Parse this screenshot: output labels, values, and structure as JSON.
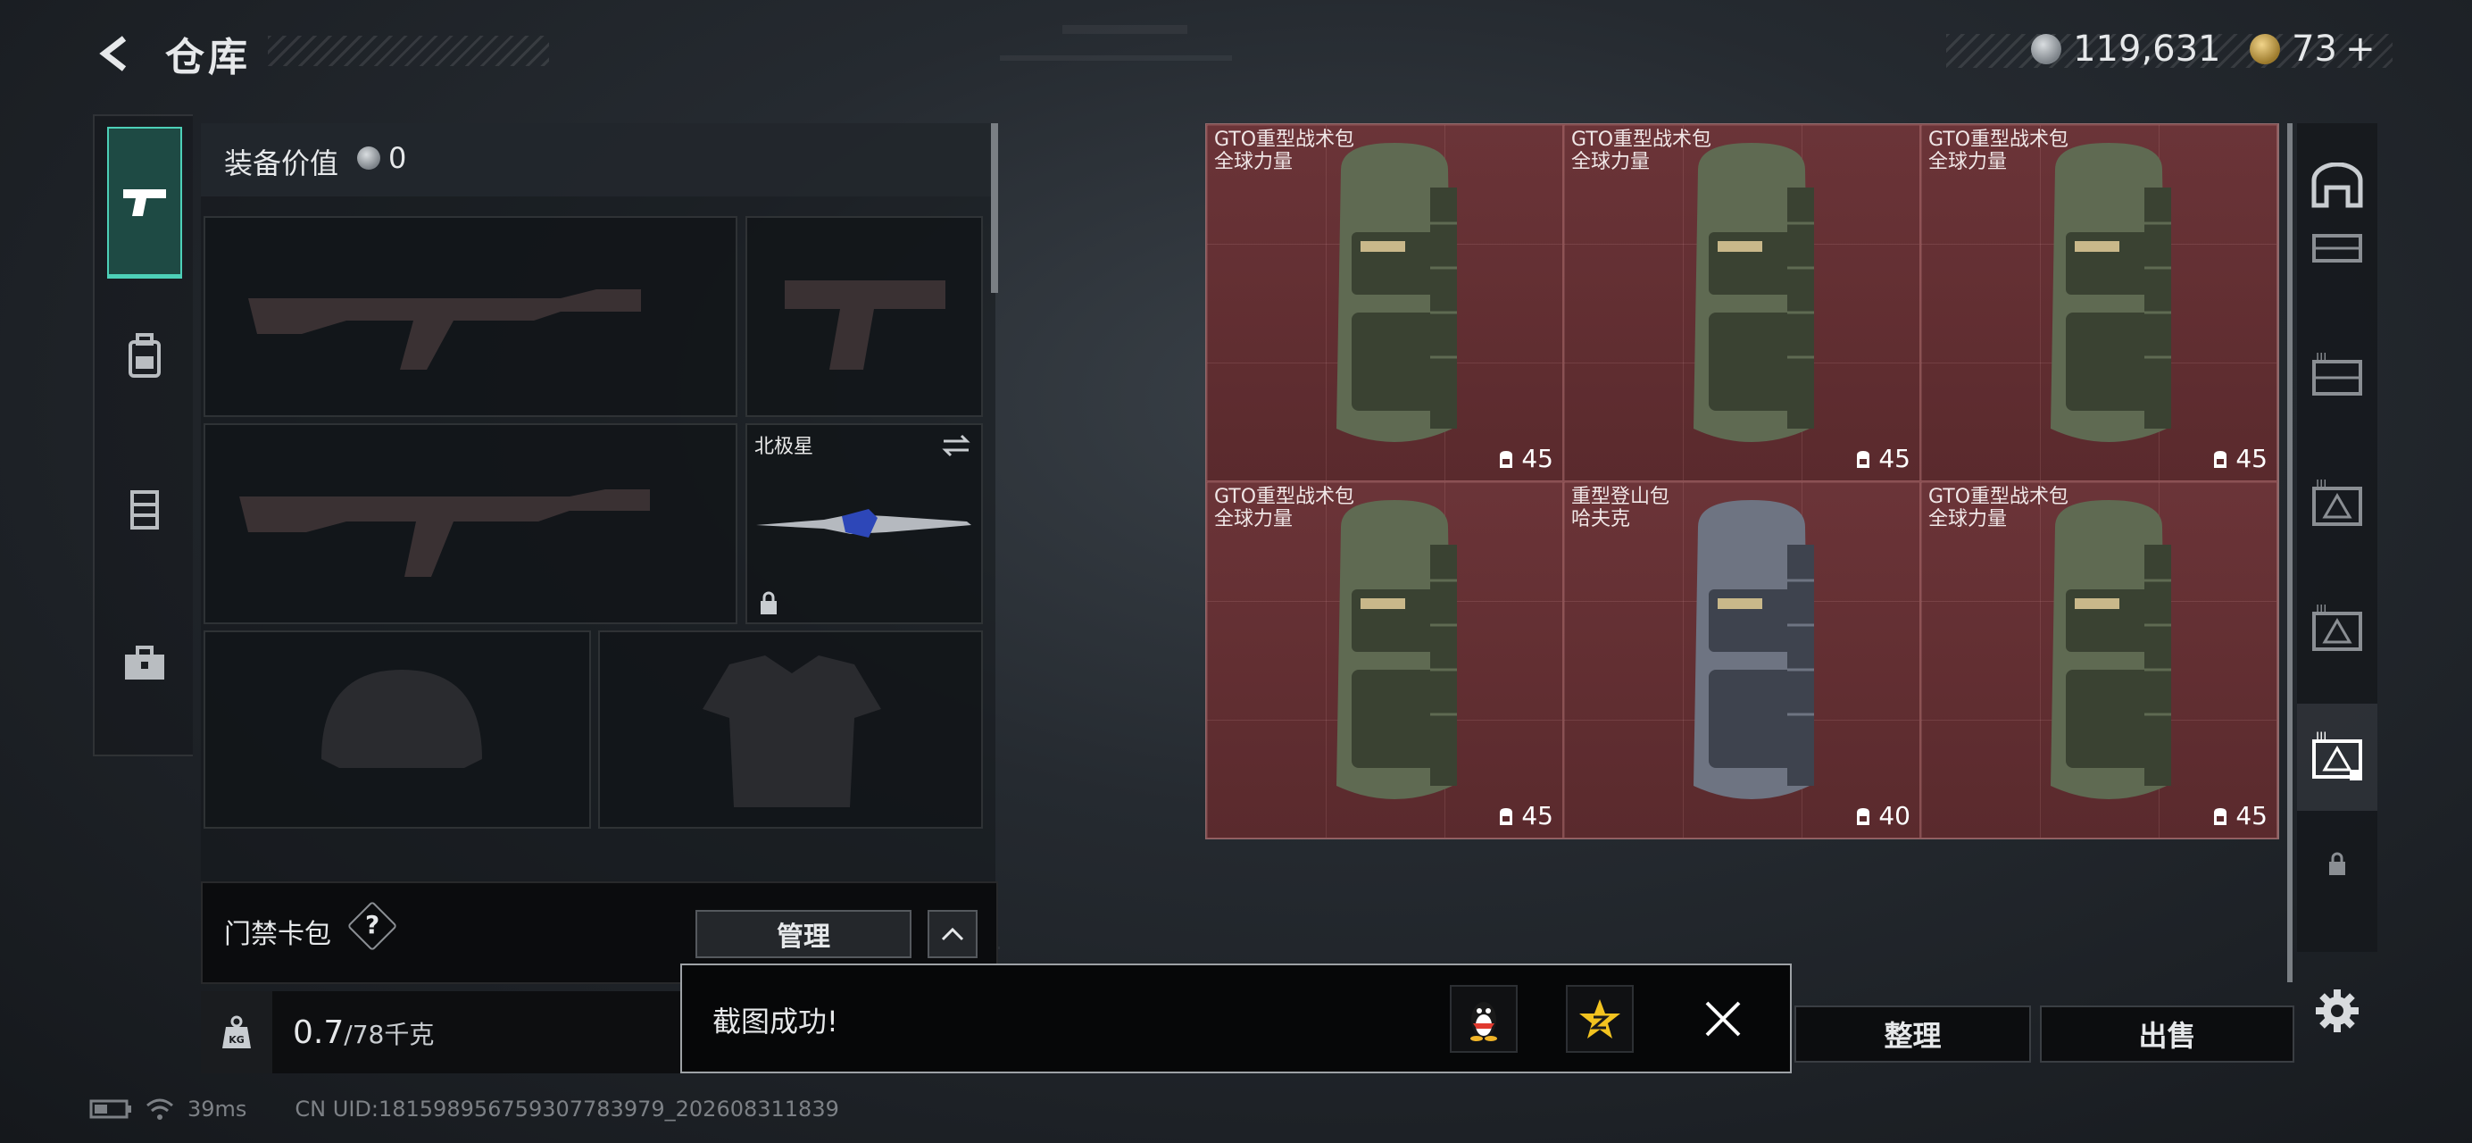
{
  "header": {
    "title": "仓库",
    "currency_primary": "119,631",
    "currency_secondary": "73",
    "add_symbol": "+"
  },
  "left_rail": {
    "items": [
      {
        "icon": "pistol-icon",
        "active": true
      },
      {
        "icon": "backpack-icon",
        "active": false
      },
      {
        "icon": "vest-icon",
        "active": false
      },
      {
        "icon": "toolbox-icon",
        "active": false
      }
    ]
  },
  "equipment": {
    "value_label": "装备价值",
    "value": "0",
    "melee_name": "北极星"
  },
  "keycard": {
    "label": "门禁卡包",
    "help": "?",
    "manage_label": "管理"
  },
  "weight": {
    "current": "0.7",
    "max": "/78千克"
  },
  "stash": {
    "items": [
      {
        "name": "GTO重型战术包",
        "sub": "全球力量",
        "capacity": "45",
        "color": "green"
      },
      {
        "name": "GTO重型战术包",
        "sub": "全球力量",
        "capacity": "45",
        "color": "green"
      },
      {
        "name": "GTO重型战术包",
        "sub": "全球力量",
        "capacity": "45",
        "color": "green"
      },
      {
        "name": "GTO重型战术包",
        "sub": "全球力量",
        "capacity": "45",
        "color": "green"
      },
      {
        "name": "重型登山包",
        "sub": "哈夫克",
        "capacity": "40",
        "color": "gray"
      },
      {
        "name": "GTO重型战术包",
        "sub": "全球力量",
        "capacity": "45",
        "color": "green"
      }
    ]
  },
  "actions": {
    "sort_label": "整理",
    "sell_label": "出售"
  },
  "toast": {
    "message": "截图成功!"
  },
  "status_bar": {
    "ping": "39ms",
    "uid": "CN UID:1815989567593077839​79_202608311839"
  },
  "colors": {
    "accent": "#4dd0b8",
    "stash_bg": "#5c2b2e",
    "bag_green": "#5f6a52",
    "bag_gray": "#6e7482"
  }
}
